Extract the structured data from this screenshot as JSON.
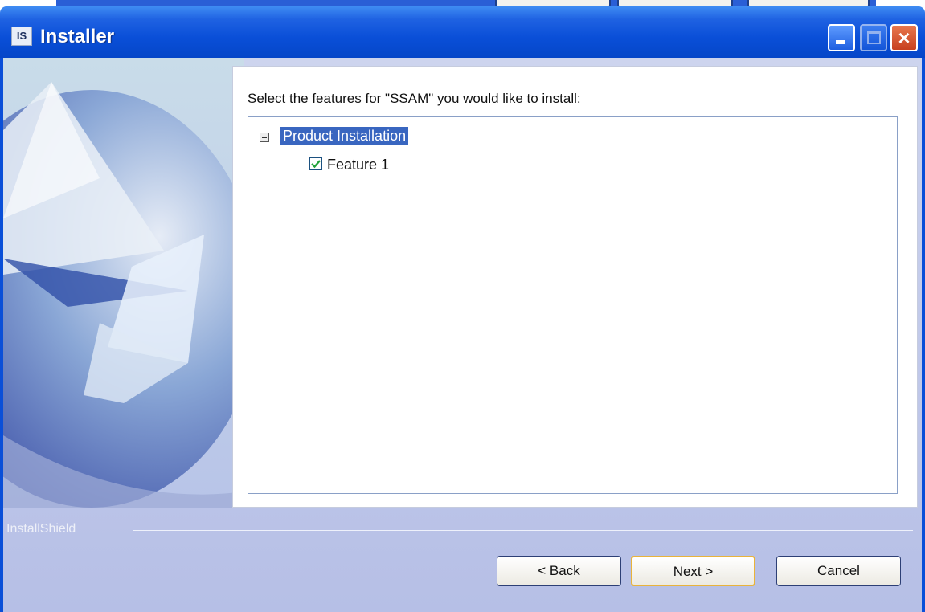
{
  "window": {
    "title": "Installer",
    "icon": "IS",
    "title_color": "#0a4fd8"
  },
  "titlebar_buttons": {
    "minimize": "minimize-icon",
    "maximize": "maximize-icon",
    "close": "×"
  },
  "main": {
    "prompt": "Select the features for \"SSAM\" you would like to install:",
    "tree": {
      "root_label": "Product Installation",
      "root_expanded": true,
      "children": [
        {
          "label": "Feature 1",
          "checked": true
        }
      ]
    }
  },
  "divider": {
    "brand": "InstallShield"
  },
  "buttons": {
    "back": "< Back",
    "next": "Next >",
    "cancel": "Cancel"
  }
}
